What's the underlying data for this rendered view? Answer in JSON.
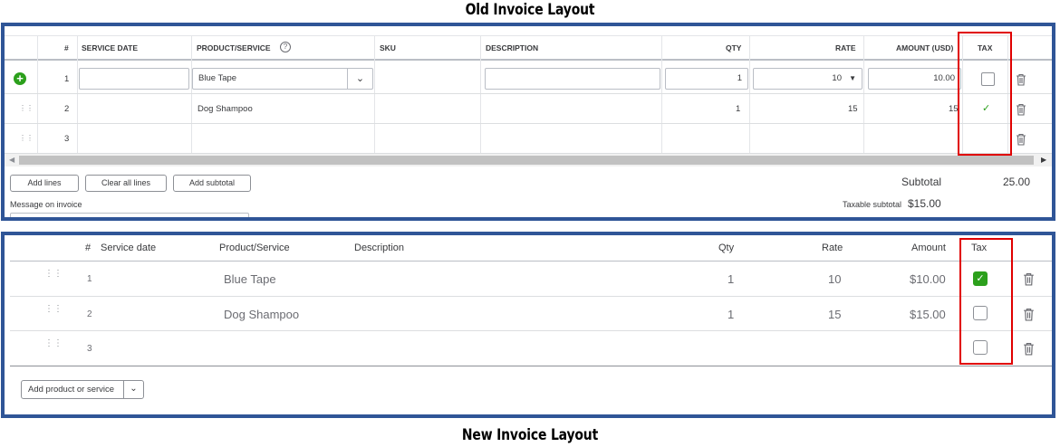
{
  "captions": {
    "old": "Old Invoice Layout",
    "new": "New Invoice Layout"
  },
  "old_layout": {
    "headers": {
      "num": "#",
      "service_date": "SERVICE DATE",
      "product": "PRODUCT/SERVICE",
      "sku": "SKU",
      "description": "DESCRIPTION",
      "qty": "QTY",
      "rate": "RATE",
      "amount": "AMOUNT (USD)",
      "tax": "TAX"
    },
    "rows": [
      {
        "num": "1",
        "product": "Blue Tape",
        "qty": "1",
        "rate": "10",
        "amount": "10.00",
        "tax": "unchecked-box"
      },
      {
        "num": "2",
        "product": "Dog Shampoo",
        "qty": "1",
        "rate": "15",
        "amount": "15",
        "tax": "check"
      },
      {
        "num": "3",
        "product": "",
        "qty": "",
        "rate": "",
        "amount": "",
        "tax": ""
      }
    ],
    "buttons": {
      "add_lines": "Add lines",
      "clear_all": "Clear all lines",
      "add_subtotal": "Add subtotal"
    },
    "message_label": "Message on invoice",
    "subtotal_label": "Subtotal",
    "subtotal_value": "25.00",
    "taxable_label": "Taxable subtotal",
    "taxable_value": "$15.00"
  },
  "new_layout": {
    "headers": {
      "num": "#",
      "service_date": "Service date",
      "product": "Product/Service",
      "description": "Description",
      "qty": "Qty",
      "rate": "Rate",
      "amount": "Amount",
      "tax": "Tax"
    },
    "rows": [
      {
        "num": "1",
        "product": "Blue Tape",
        "qty": "1",
        "rate": "10",
        "amount": "$10.00",
        "tax_checked": true
      },
      {
        "num": "2",
        "product": "Dog Shampoo",
        "qty": "1",
        "rate": "15",
        "amount": "$15.00",
        "tax_checked": false
      },
      {
        "num": "3",
        "product": "",
        "qty": "",
        "rate": "",
        "amount": "",
        "tax_checked": false
      }
    ],
    "add_button": "Add product or service"
  },
  "colors": {
    "frame": "#2f5597",
    "highlight": "#e00000",
    "check_green": "#2ca01c",
    "add_green": "#2ca01c"
  }
}
